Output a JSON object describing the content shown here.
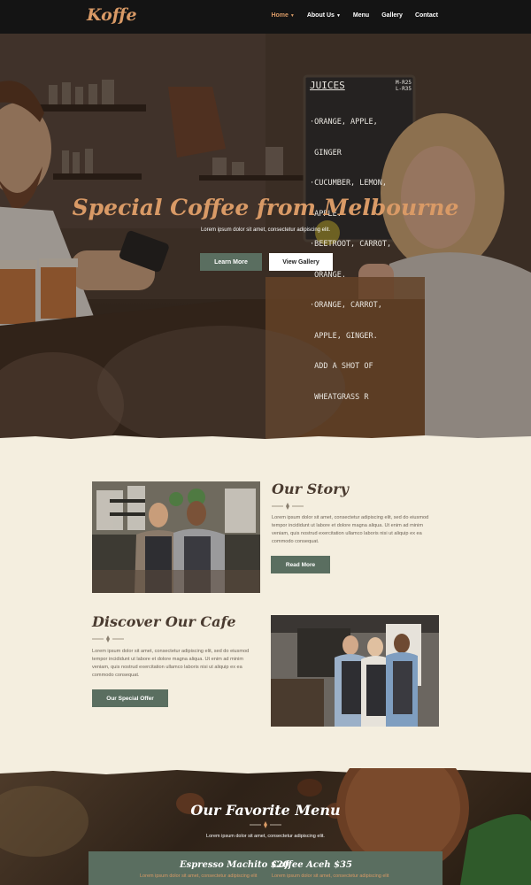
{
  "brand": {
    "name": "Koffe",
    "accent": "#d99a66",
    "green": "#5a6e60"
  },
  "nav": {
    "items": [
      {
        "label": "Home",
        "has_dropdown": true,
        "active": true
      },
      {
        "label": "About Us",
        "has_dropdown": true,
        "active": false
      },
      {
        "label": "Menu",
        "has_dropdown": false,
        "active": false
      },
      {
        "label": "Gallery",
        "has_dropdown": false,
        "active": false
      },
      {
        "label": "Contact",
        "has_dropdown": false,
        "active": false
      }
    ]
  },
  "hero": {
    "title": "Special Coffee from Melbourne",
    "subtitle": "Lorem ipsum dolor sit amet, consectetur adipiscing elit.",
    "primary_button": "Learn More",
    "secondary_button": "View Gallery",
    "board": {
      "heading": "JUICES",
      "prices": [
        "M-R25",
        "L-R35"
      ],
      "lines": [
        "·ORANGE, APPLE,",
        " GINGER",
        "·CUCUMBER, LEMON,",
        " APPLE.",
        "·BEETROOT, CARROT,",
        " ORANGE.",
        "·ORANGE, CARROT,",
        " APPLE, GINGER.",
        " ADD A SHOT OF",
        " WHEATGRASS R"
      ]
    }
  },
  "story": {
    "title": "Our Story",
    "text": [
      "Lorem ipsum dolor sit amet, consectetur adipiscing elit, sed do eiusmod",
      "tempor incididunt ut labore et dolore magna aliqua. Ut enim ad minim",
      "veniam, quis nostrud exercitation ullamco laboris nisi ut aliquip ex ea",
      "commodo consequat."
    ],
    "button": "Read More"
  },
  "discover": {
    "title": "Discover Our Cafe",
    "text": [
      "Lorem ipsum dolor sit amet, consectetur adipiscing elit, sed do eiusmod",
      "tempor incididunt ut labore et dolore magna aliqua. Ut enim ad minim",
      "veniam, quis nostrud exercitation ullamco laboris nisi ut aliquip ex ea",
      "commodo consequat."
    ],
    "button": "Our Special Offer"
  },
  "menu": {
    "title": "Our Favorite Menu",
    "subtitle": "Lorem ipsum dolor sit amet, consectetur adipiscing elit.",
    "items": [
      {
        "name": "Espresso Machito $20",
        "desc": "Lorem ipsum dolor sit amet, consectetur adipiscing elit"
      },
      {
        "name": "Coffee Aceh $35",
        "desc": "Lorem ipsum dolor sit amet, consectetur adipiscing elit"
      }
    ]
  }
}
